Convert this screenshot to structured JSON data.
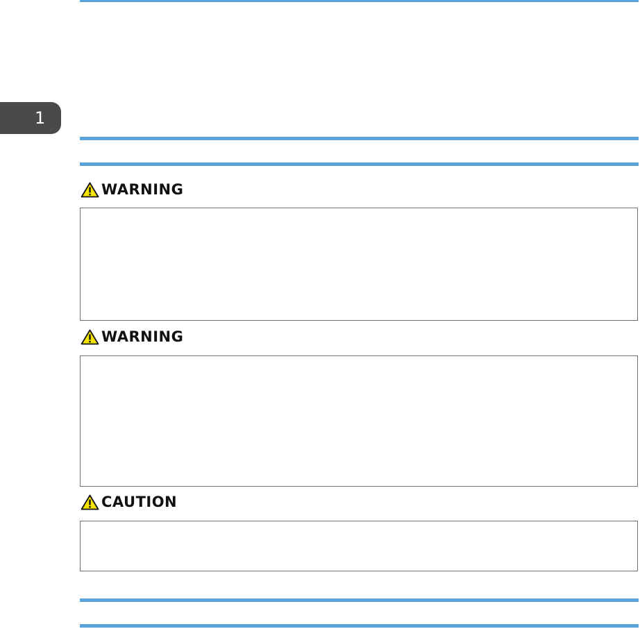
{
  "chapter_tab": {
    "number": "1"
  },
  "notices": [
    {
      "label": "WARNING",
      "icon": "warning-triangle-icon"
    },
    {
      "label": "WARNING",
      "icon": "warning-triangle-icon"
    },
    {
      "label": "CAUTION",
      "icon": "warning-triangle-icon"
    }
  ],
  "colors": {
    "rule": "#5ba3d9",
    "tab": "#4a4a4a",
    "icon_fill": "#f5e400",
    "box_border": "#6f6f6f"
  }
}
